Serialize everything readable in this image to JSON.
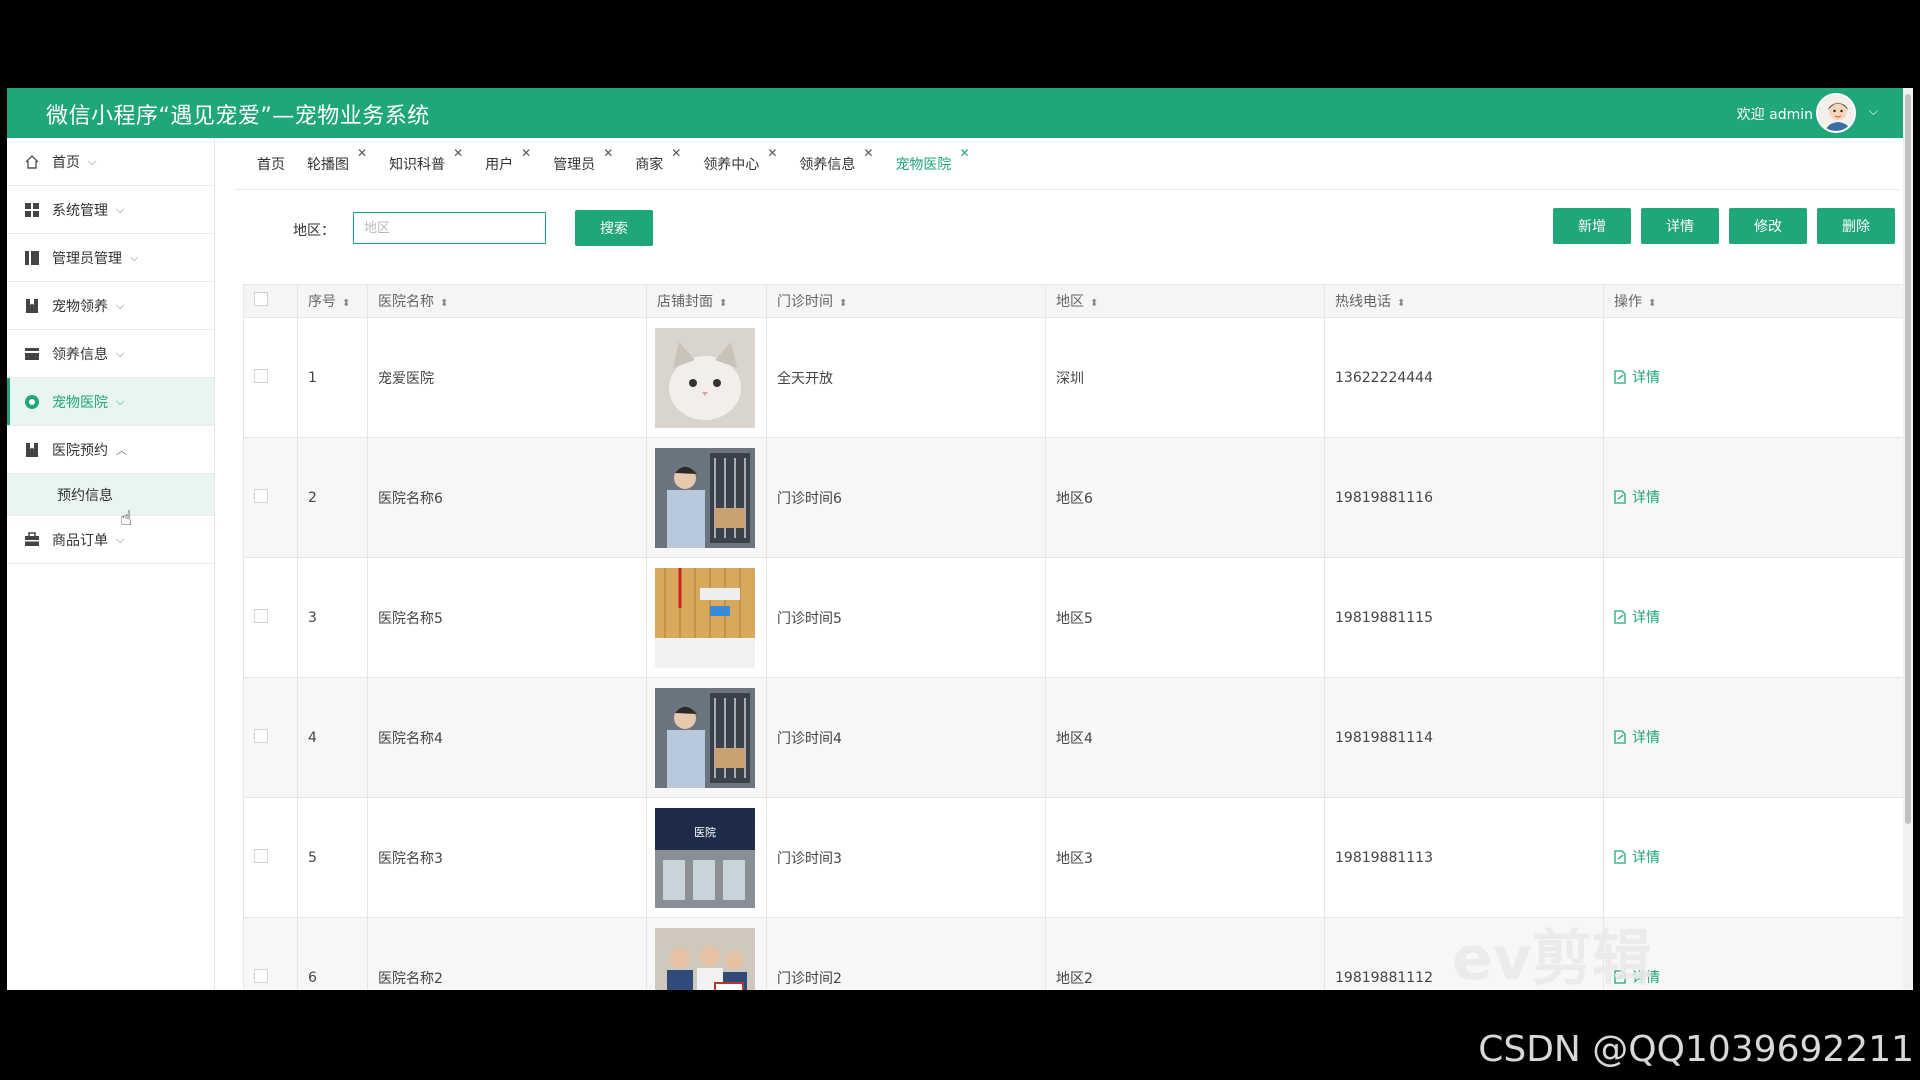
{
  "header": {
    "title": "微信小程序“遇见宠爱”—宠物业务系统",
    "welcome": "欢迎 admin"
  },
  "sidebar": {
    "items": [
      {
        "label": "首页",
        "icon": "home-icon",
        "chevron": "down"
      },
      {
        "label": "系统管理",
        "icon": "grid-icon",
        "chevron": "down"
      },
      {
        "label": "管理员管理",
        "icon": "columns-icon",
        "chevron": "down"
      },
      {
        "label": "宠物领养",
        "icon": "bookmark-icon",
        "chevron": "down"
      },
      {
        "label": "领养信息",
        "icon": "card-icon",
        "chevron": "down"
      },
      {
        "label": "宠物医院",
        "icon": "circle-dot-icon",
        "chevron": "down",
        "active": true
      },
      {
        "label": "医院预约",
        "icon": "bookmark-icon",
        "chevron": "up"
      },
      {
        "label": "商品订单",
        "icon": "briefcase-icon",
        "chevron": "down"
      }
    ],
    "sub_item": "预约信息"
  },
  "tabs": [
    {
      "label": "首页",
      "closable": false
    },
    {
      "label": "轮播图",
      "closable": true
    },
    {
      "label": "知识科普",
      "closable": true
    },
    {
      "label": "用户",
      "closable": true
    },
    {
      "label": "管理员",
      "closable": true
    },
    {
      "label": "商家",
      "closable": true
    },
    {
      "label": "领养中心",
      "closable": true
    },
    {
      "label": "领养信息",
      "closable": true
    },
    {
      "label": "宠物医院",
      "closable": true,
      "active": true
    }
  ],
  "search": {
    "label": "地区：",
    "placeholder": "地区",
    "button": "搜索"
  },
  "actions": {
    "add": "新增",
    "detail": "详情",
    "edit": "修改",
    "delete": "删除"
  },
  "table": {
    "columns": [
      "序号",
      "医院名称",
      "店铺封面",
      "门诊时间",
      "地区",
      "热线电话",
      "操作"
    ],
    "rows": [
      {
        "no": "1",
        "name": "宠爱医院",
        "cover": "cat-photo",
        "hours": "全天开放",
        "region": "深圳",
        "phone": "13622224444",
        "action": "详情"
      },
      {
        "no": "2",
        "name": "医院名称6",
        "cover": "vet-photo",
        "hours": "门诊时间6",
        "region": "地区6",
        "phone": "19819881116",
        "action": "详情"
      },
      {
        "no": "3",
        "name": "医院名称5",
        "cover": "reception-photo",
        "hours": "门诊时间5",
        "region": "地区5",
        "phone": "19819881115",
        "action": "详情"
      },
      {
        "no": "4",
        "name": "医院名称4",
        "cover": "vet-photo",
        "hours": "门诊时间4",
        "region": "地区4",
        "phone": "19819881114",
        "action": "详情"
      },
      {
        "no": "5",
        "name": "医院名称3",
        "cover": "storefront-photo",
        "hours": "门诊时间3",
        "region": "地区3",
        "phone": "19819881113",
        "action": "详情"
      },
      {
        "no": "6",
        "name": "医院名称2",
        "cover": "staff-photo",
        "hours": "门诊时间2",
        "region": "地区2",
        "phone": "19819881112",
        "action": "详情"
      }
    ]
  },
  "overlay": {
    "watermark": "ev剪辑",
    "credit": "CSDN @QQ1039692211"
  },
  "colors": {
    "accent": "#1fa67a",
    "active_bg": "#e8f6ef"
  }
}
